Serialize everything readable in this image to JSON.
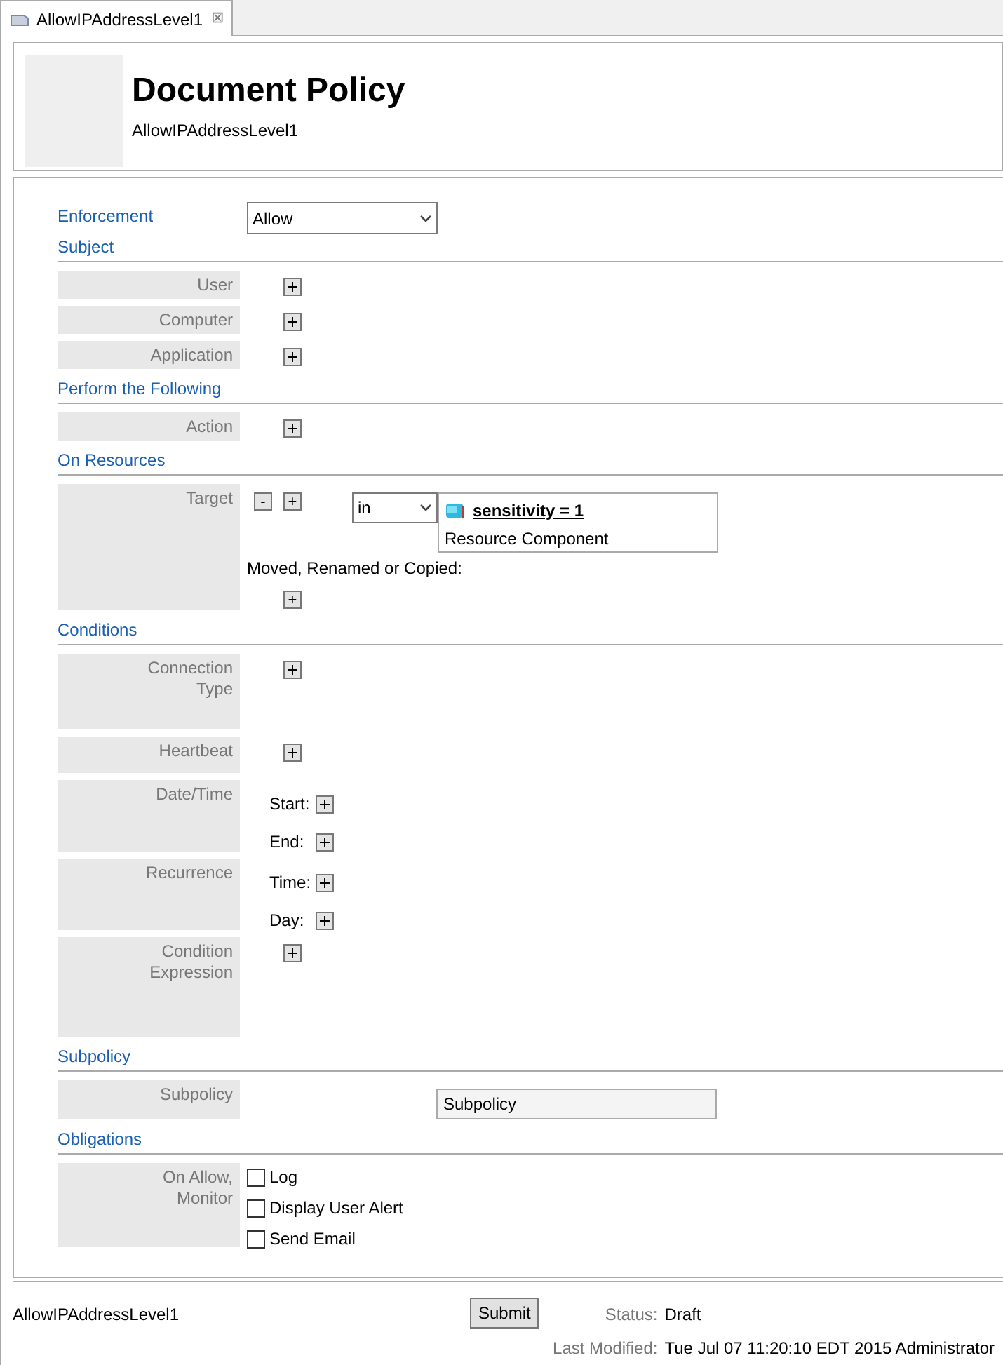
{
  "tab": {
    "title": "AllowIPAddressLevel1",
    "close": "⊠"
  },
  "header": {
    "title": "Document Policy",
    "subtitle": "AllowIPAddressLevel1"
  },
  "enforcement": {
    "label": "Enforcement",
    "value": "Allow"
  },
  "sections": [
    {
      "title": "Subject",
      "rows": [
        {
          "kind": "add",
          "label": "User"
        },
        {
          "kind": "add",
          "label": "Computer"
        },
        {
          "kind": "add",
          "label": "Application"
        }
      ]
    },
    {
      "title": "Perform the Following",
      "rows": [
        {
          "kind": "add",
          "label": "Action"
        }
      ]
    },
    {
      "title": "On Resources",
      "rows": [
        {
          "kind": "target",
          "label": "Target",
          "minus": "-",
          "plus": "+",
          "operator": "in",
          "resource_name": "sensitivity = 1",
          "resource_type": "Resource Component",
          "moved_label": "Moved, Renamed or Copied:",
          "moved_plus": "+"
        }
      ]
    },
    {
      "title": "Conditions",
      "rows": [
        {
          "kind": "add",
          "label": "Connection Type"
        },
        {
          "kind": "add",
          "label": "Heartbeat"
        },
        {
          "kind": "multi",
          "label": "Date/Time",
          "items": [
            "Start:",
            "End:"
          ]
        },
        {
          "kind": "multi",
          "label": "Recurrence",
          "items": [
            "Time:",
            "Day:"
          ]
        },
        {
          "kind": "add",
          "label": "Condition Expression"
        }
      ]
    },
    {
      "title": "Subpolicy",
      "rows": [
        {
          "kind": "field",
          "label": "Subpolicy",
          "value": "Subpolicy"
        }
      ]
    },
    {
      "title": "Obligations",
      "rows": [
        {
          "kind": "checks",
          "label": "On Allow, Monitor",
          "options": [
            {
              "label": "Log",
              "checked": false
            },
            {
              "label": "Display User Alert",
              "checked": false
            },
            {
              "label": "Send Email",
              "checked": false
            }
          ]
        }
      ]
    }
  ],
  "footer": {
    "name": "AllowIPAddressLevel1",
    "submit": "Submit",
    "status_label": "Status:",
    "status": "Draft",
    "modified_label": "Last Modified:",
    "modified": "Tue Jul 07 11:20:10 EDT 2015 Administrator"
  }
}
